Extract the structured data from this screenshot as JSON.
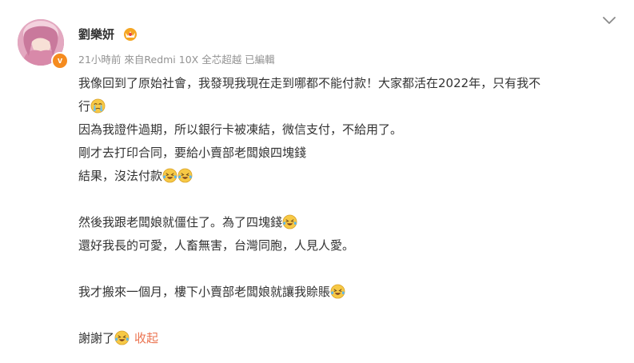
{
  "post": {
    "username": "劉樂妍",
    "meta": "21小時前  來自Redmi 10X 全芯超越  已編輯",
    "badge": "v",
    "lines": {
      "l1": "我像回到了原始社會，我發現我現在走到哪都不能付款！大家都活在2022年，只有我不",
      "l2": "行",
      "l3": "因為我證件過期，所以銀行卡被凍結，微信支付，不給用了。",
      "l4": "剛才去打印合同，要給小賣部老闆娘四塊錢",
      "l5": "結果，沒法付款",
      "l6": "然後我跟老闆娘就僵住了。為了四塊錢",
      "l7": "還好我長的可愛，人畜無害，台灣同胞，人見人愛。",
      "l8": "我才搬來一個月，樓下小賣部老闆娘就讓我賒賬",
      "l9": "謝謝了"
    },
    "collapse_label": "收起"
  },
  "icons": {
    "avatar": "avatar-photo",
    "verified": "verified-badge-icon",
    "crown": "crown-icon",
    "menu": "chevron-down-icon",
    "emoji_crying": "crying-emoji-icon",
    "emoji_laugh_cry": "laugh-cry-emoji-icon"
  },
  "colors": {
    "text": "#333333",
    "meta": "#939393",
    "link": "#eb7350",
    "badge": "#f58b1f"
  }
}
